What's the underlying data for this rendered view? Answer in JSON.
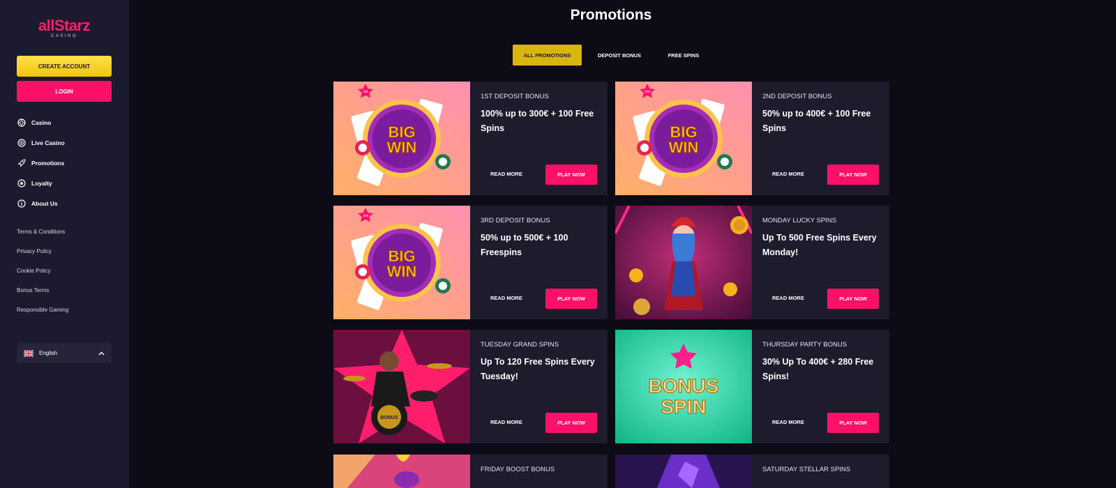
{
  "brand": {
    "name": "allStarz",
    "sub": "CASINO"
  },
  "sidebar": {
    "create_account": "CREATE ACCOUNT",
    "login": "LOGIN",
    "nav": [
      {
        "label": "Casino",
        "icon": "chip-icon"
      },
      {
        "label": "Live Casino",
        "icon": "live-chip-icon"
      },
      {
        "label": "Promotions",
        "icon": "rocket-icon"
      },
      {
        "label": "Loyalty",
        "icon": "star-circle-icon"
      },
      {
        "label": "About Us",
        "icon": "info-icon"
      }
    ],
    "links": [
      "Terms & Conditions",
      "Privacy Policy",
      "Cookie Policy",
      "Bonus Terms",
      "Responsible Gaming"
    ],
    "language": "English"
  },
  "main": {
    "title": "Promotions",
    "tabs": [
      "ALL PROMOTIONS",
      "DEPOSIT BONUS",
      "FREE SPINS"
    ],
    "active_tab": "ALL PROMOTIONS",
    "read_more": "READ MORE",
    "play_now": "PLAY NOW",
    "cards": [
      {
        "sub": "1ST DEPOSIT BONUS",
        "title": "100% up to 300€ + 100 Free Spins",
        "badge": "1st",
        "img_text": "BIG WIN"
      },
      {
        "sub": "2ND DEPOSIT BONUS",
        "title": "50% up to 400€ + 100 Free Spins",
        "badge": "2nd",
        "img_text": "BIG WIN"
      },
      {
        "sub": "3RD DEPOSIT BONUS",
        "title": "50% up to 500€ + 100 Freespins",
        "badge": "3rd",
        "img_text": "BIG WIN"
      },
      {
        "sub": "MONDAY LUCKY SPINS",
        "title": "Up To 500 Free Spins Every Monday!"
      },
      {
        "sub": "TUESDAY GRAND SPINS",
        "title": "Up To 120 Free Spins Every Tuesday!",
        "img_text": "BONUS"
      },
      {
        "sub": "THURSDAY PARTY BONUS",
        "title": "30% Up To 400€ + 280 Free Spins!",
        "img_text": "BONUS SPIN"
      },
      {
        "sub": "FRIDAY BOOST BONUS",
        "title": ""
      },
      {
        "sub": "SATURDAY STELLAR SPINS",
        "title": ""
      }
    ]
  },
  "colors": {
    "accent_pink": "#ff1068",
    "accent_yellow": "#d8b60d",
    "bg": "#0d0b15",
    "sidebar": "#1c1a2e",
    "card": "#1d1b2c"
  }
}
